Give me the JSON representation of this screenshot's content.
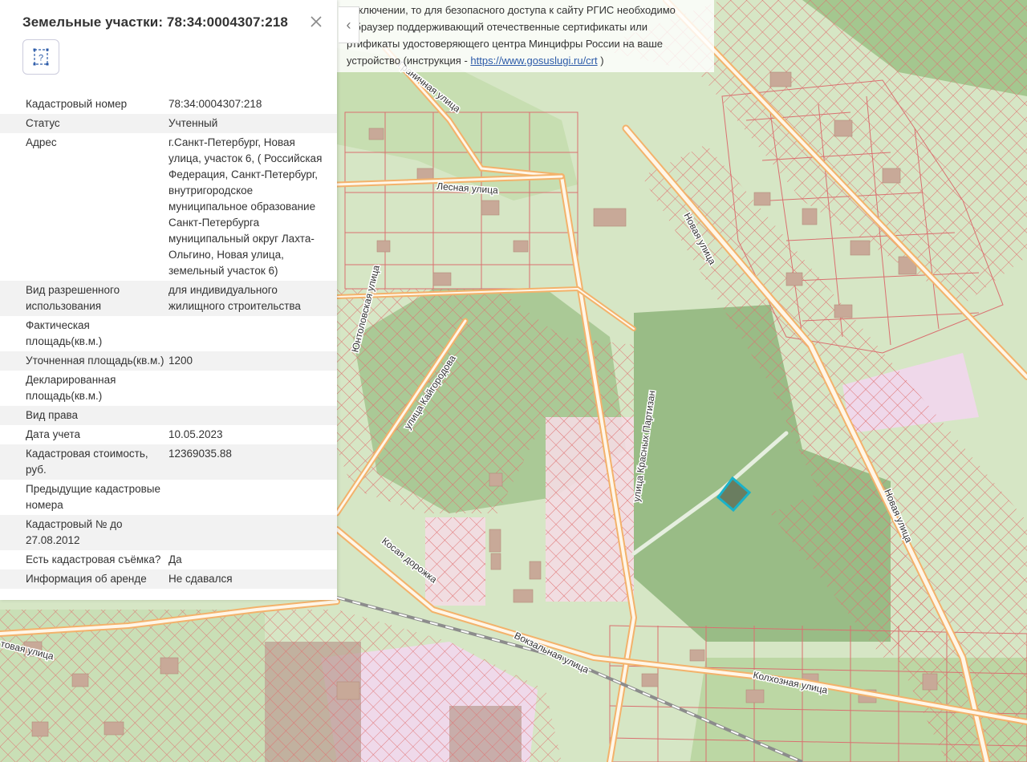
{
  "notice": {
    "line1": "одключении, то для безопасного доступа к сайту РГИС необходимо",
    "line2": "ь браузер поддерживающий отечественные сертификаты или",
    "line3": "ртификаты удостоверяющего центра Минцифры России на ваше",
    "line4_prefix": "устройство (инструкция - ",
    "line4_link": "https://www.gosuslugi.ru/crt",
    "line4_suffix": " )"
  },
  "panel": {
    "title": "Земельные участки: 78:34:0004307:218",
    "close_icon": "close-icon",
    "tool_icon": "unknown-frame-icon",
    "tool_glyph": "?",
    "collapse_glyph": "‹",
    "rows": [
      {
        "key": "Кадастровый номер",
        "value": "78:34:0004307:218"
      },
      {
        "key": "Статус",
        "value": "Учтенный"
      },
      {
        "key": "Адрес",
        "value": "г.Санкт-Петербург, Новая улица, участок 6, ( Российская Федерация, Санкт-Петербург, внутригородское муниципальное образование Санкт-Петербурга муниципальный округ Лахта-Ольгино, Новая улица, земельный участок 6)"
      },
      {
        "key": "Вид разрешенного использования",
        "value": "для индивидуального жилищного строительства"
      },
      {
        "key": "Фактическая площадь(кв.м.)",
        "value": ""
      },
      {
        "key": "Уточненная площадь(кв.м.)",
        "value": "1200"
      },
      {
        "key": "Декларированная площадь(кв.м.)",
        "value": ""
      },
      {
        "key": "Вид права",
        "value": ""
      },
      {
        "key": "Дата учета",
        "value": "10.05.2023"
      },
      {
        "key": "Кадастровая стоимость, руб.",
        "value": "12369035.88"
      },
      {
        "key": "Предыдущие кадастровые номера",
        "value": ""
      },
      {
        "key": "Кадастровый № до 27.08.2012",
        "value": ""
      },
      {
        "key": "Есть кадастровая съёмка?",
        "value": "Да"
      },
      {
        "key": "Информация об аренде",
        "value": "Не сдавался"
      }
    ]
  },
  "map": {
    "street_labels": [
      "Граничная улица",
      "Лесная улица",
      "Новая улица",
      "Новая улица",
      "Юнтоловская улица",
      "улица Кайгородова",
      "улица Красных Партизан",
      "Косая дорожка",
      "Вокзальная улица",
      "Колхозная улица",
      "товая улица"
    ],
    "colors": {
      "background": "#d9e7c9",
      "forest": "#8fb57a",
      "road": "#f3b26b",
      "parcel": "#e46a6a",
      "selected": "#1ab2c9"
    }
  }
}
